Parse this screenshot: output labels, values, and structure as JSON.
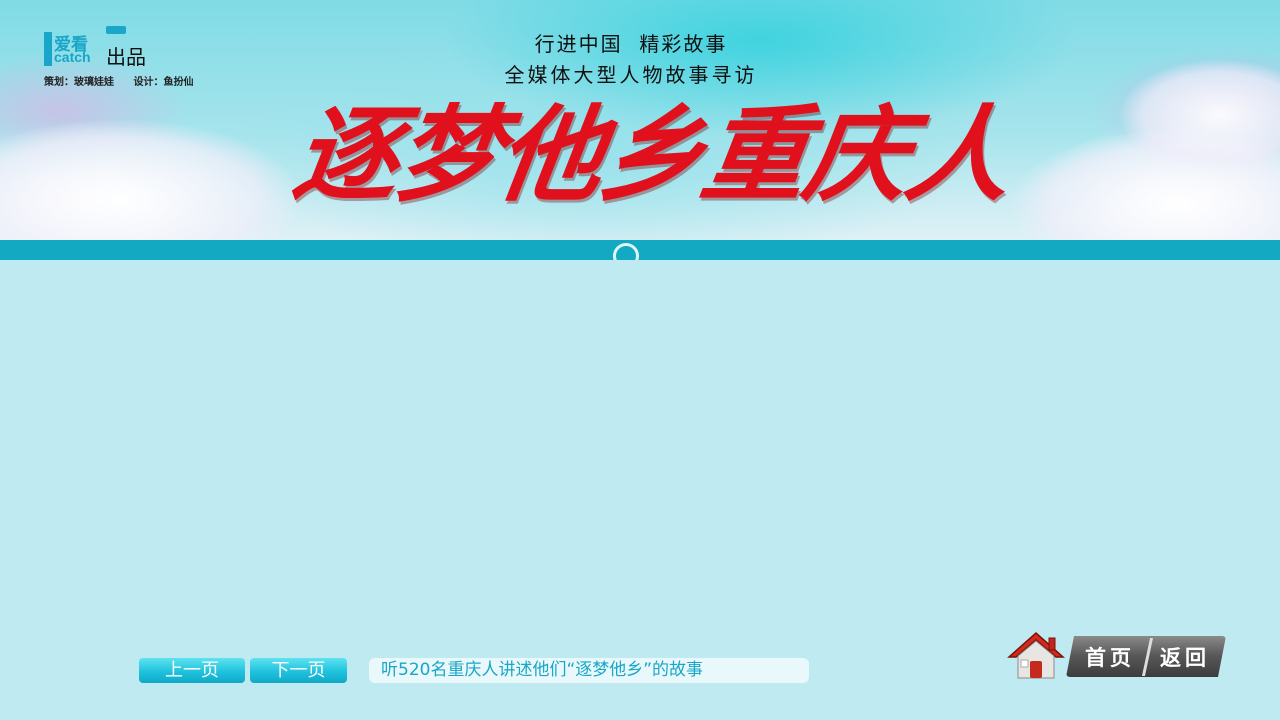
{
  "header": {
    "logo_cn": "爱看",
    "logo_en": "catch",
    "logo_produced": "出品",
    "credit_planner": "策划：玻璃娃娃",
    "credit_designer": "设计：鱼扮仙",
    "tagline_line1": "行进中国  精彩故事",
    "tagline_line2": "全媒体大型人物故事寻访",
    "main_title": "逐梦他乡重庆人",
    "title_color": "#e0101c"
  },
  "footer": {
    "prev_label": "上一页",
    "next_label": "下一页",
    "caption": "听520名重庆人讲述他们“逐梦他乡”的故事",
    "home_label": "首页",
    "back_label": "返回"
  },
  "colors": {
    "background": "#c0eaf1",
    "divider": "#13a9c3",
    "accent": "#1aa6c8"
  }
}
